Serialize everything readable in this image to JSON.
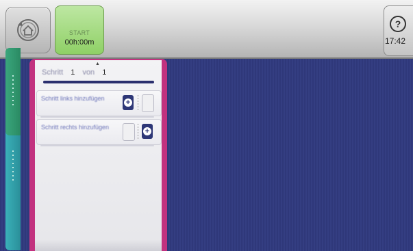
{
  "toolbar": {
    "start_label": "START",
    "timer": "00h:00m",
    "help_symbol": "?",
    "clock": "17:42"
  },
  "step_panel": {
    "step_word": "Schritt",
    "current_step": "1",
    "of_word": "von",
    "total_steps": "1",
    "add_left_label": "Schritt links hinzufügen",
    "add_right_label": "Schritt rechts hinzufügen",
    "plus_symbol": "+"
  },
  "colors": {
    "background": "#2e3777",
    "accent_magenta": "#c2327f",
    "start_green": "#8fd066",
    "tab_green": "#3aa67c",
    "tab_teal": "#3ab0b9"
  },
  "icons": {
    "home": "home-back-icon",
    "help": "help-icon",
    "plus": "plus-circle-icon",
    "up": "up-arrow-icon"
  }
}
